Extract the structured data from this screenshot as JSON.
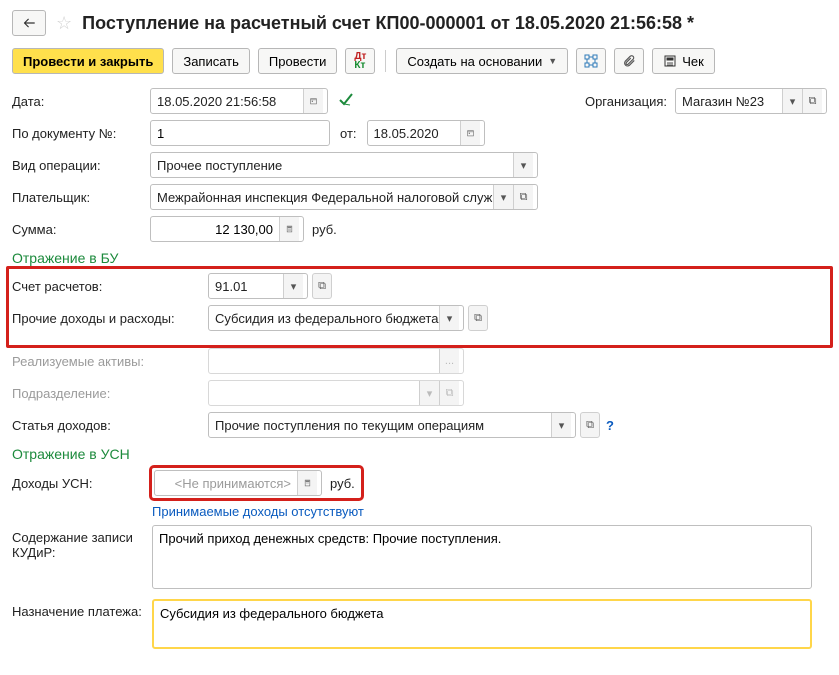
{
  "header": {
    "title": "Поступление на расчетный счет КП00-000001 от 18.05.2020 21:56:58 *"
  },
  "toolbar": {
    "post_close": "Провести и закрыть",
    "save": "Записать",
    "post": "Провести",
    "create_based": "Создать на основании",
    "check": "Чек"
  },
  "labels": {
    "date": "Дата:",
    "org": "Организация:",
    "by_doc_no": "По документу №:",
    "from": "от:",
    "op_kind": "Вид операции:",
    "payer": "Плательщик:",
    "amount": "Сумма:",
    "section_bu": "Отражение в БУ",
    "acc": "Счет расчетов:",
    "other_inc": "Прочие доходы и расходы:",
    "assets": "Реализуемые активы:",
    "division": "Подразделение:",
    "income_item": "Статья доходов:",
    "section_usn": "Отражение в УСН",
    "usn_income": "Доходы УСН:",
    "usn_link": "Принимаемые доходы отсутствуют",
    "kudir": "Содержание записи КУДиР:",
    "purpose": "Назначение платежа:",
    "currency": "руб."
  },
  "values": {
    "date": "18.05.2020 21:56:58",
    "org": "Магазин №23",
    "doc_no": "1",
    "doc_date": "18.05.2020",
    "op_kind": "Прочее поступление",
    "payer": "Межрайонная инспекция Федеральной налоговой службы",
    "amount": "12 130,00",
    "acc": "91.01",
    "other_inc": "Субсидия из федерального бюджета",
    "income_item": "Прочие поступления по текущим операциям",
    "usn_income": "<Не принимаются>",
    "kudir": "Прочий приход денежных средств: Прочие поступления.",
    "purpose": "Субсидия из федерального бюджета"
  }
}
